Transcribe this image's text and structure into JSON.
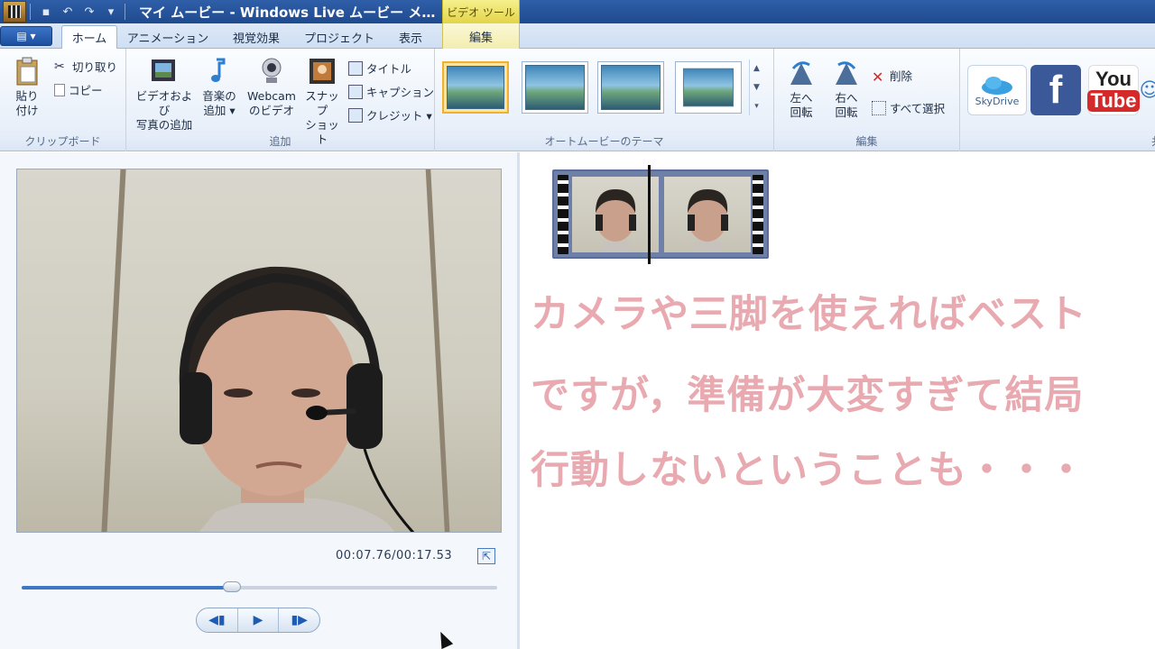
{
  "window": {
    "title": "マイ ムービー - Windows Live ムービー メ…",
    "context_tab_group": "ビデオ ツール"
  },
  "tabs": [
    {
      "label": "ホーム",
      "active": true
    },
    {
      "label": "アニメーション"
    },
    {
      "label": "視覚効果"
    },
    {
      "label": "プロジェクト"
    },
    {
      "label": "表示"
    },
    {
      "label": "編集",
      "contextual": true
    }
  ],
  "ribbon": {
    "clipboard": {
      "paste_line1": "貼り",
      "paste_line2": "付け",
      "cut": "切り取り",
      "copy": "コピー",
      "label": "クリップボード"
    },
    "add": {
      "add_video_line1": "ビデオおよび",
      "add_video_line2": "写真の追加",
      "add_music_line1": "音楽の",
      "add_music_line2": "追加 ▾",
      "webcam_line1": "Webcam",
      "webcam_line2": "のビデオ",
      "snapshot_line1": "スナップ",
      "snapshot_line2": "ショット",
      "title": "タイトル",
      "caption": "キャプション",
      "credits": "クレジット ▾",
      "label": "追加"
    },
    "themes": {
      "label": "オートムービーのテーマ"
    },
    "editing": {
      "rotate_left_line1": "左へ",
      "rotate_left_line2": "回転",
      "rotate_right_line1": "右へ",
      "rotate_right_line2": "回転",
      "delete": "削除",
      "select_all": "すべて選択",
      "label": "編集"
    },
    "share": {
      "skydrive": "SkyDrive",
      "facebook": "f",
      "youtube_line1": "You",
      "youtube_line2": "Tube",
      "label": "共有"
    }
  },
  "preview": {
    "time": "00:07.76/00:17.53",
    "progress_fraction": 0.4427
  },
  "storyboard": {
    "caption_lines": [
      "カメラや三脚を使えればベスト",
      "ですが，準備が大変すぎて結局",
      "行動しないということも・・・"
    ]
  },
  "colors": {
    "caption_text": "#e8aab0",
    "accent": "#3d78c4",
    "context_tab": "#f3e85c"
  }
}
